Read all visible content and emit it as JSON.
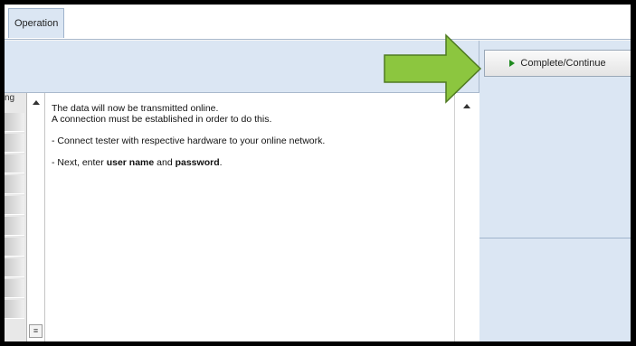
{
  "tabs": [
    {
      "label": "Operation"
    }
  ],
  "left_list": {
    "header_fragment": "ng"
  },
  "actions": {
    "complete_label": "Complete/Continue"
  },
  "message": {
    "line1": "The data will now be transmitted online.",
    "line2": "A connection must be established in order to do this.",
    "line3": "- Connect tester with respective hardware to your online network.",
    "line4_prefix": "- Next, enter ",
    "line4_bold1": "user name",
    "line4_mid": " and ",
    "line4_bold2": "password",
    "line4_suffix": "."
  },
  "icons": {
    "scroll_up_left": "chevron-up-icon",
    "scroll_up_right": "chevron-up-icon",
    "menu": "menu-icon",
    "play": "play-icon",
    "pointer_arrow": "arrow-right-icon"
  },
  "colors": {
    "panel_blue": "#dbe6f3",
    "play_green": "#1f8a1f",
    "pointer_green": "#8cc63f"
  }
}
